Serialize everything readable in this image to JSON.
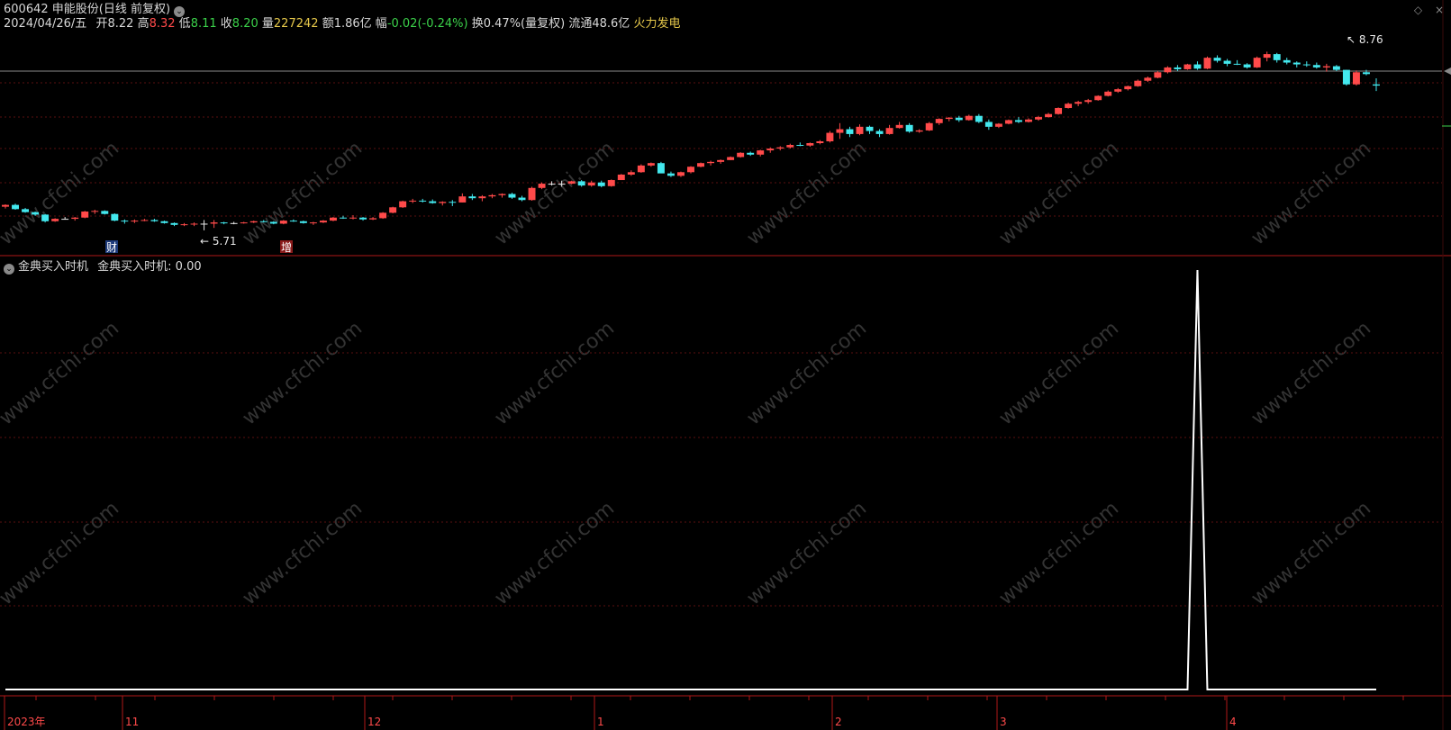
{
  "header": {
    "code": "600642",
    "name": "申能股份",
    "period": "(日线 前复权)",
    "dropdown_icon": "chevron-down-icon"
  },
  "info": {
    "date": "2024/04/26/五",
    "open_label": "开",
    "open": "8.22",
    "high_label": "高",
    "high": "8.32",
    "low_label": "低",
    "low": "8.11",
    "close_label": "收",
    "close": "8.20",
    "vol_label": "量",
    "vol": "227242",
    "amt_label": "额",
    "amt": "1.86亿",
    "chg_label": "幅",
    "chg": "-0.02(-0.24%)",
    "turn_label": "换",
    "turn": "0.47%(量复权)",
    "float_label": "流通",
    "float": "48.6亿",
    "sector": "火力发电"
  },
  "window_controls": {
    "restore": "◇",
    "close": "×"
  },
  "indicator": {
    "title": "金典买入时机",
    "line_name": "金典买入时机: 0.00"
  },
  "annotations": {
    "low_label": "5.71",
    "high_label": "8.76",
    "badge_cai": "财",
    "badge_zeng": "增"
  },
  "watermark": "www.cfchi.com",
  "colors": {
    "up": "#ff4a4a",
    "down": "#43e8ee",
    "flat": "#e8e8e8",
    "grid": "#5a0f0f",
    "axis": "#b01818",
    "price_line": "#8a8a8a"
  },
  "x_axis": {
    "labels": [
      "2023年",
      "11",
      "12",
      "1",
      "2",
      "3",
      "4"
    ]
  },
  "chart_data": {
    "type": "candlestick",
    "title": "",
    "price_range": [
      5.6,
      8.9
    ],
    "low_marker": 5.71,
    "high_marker": 8.76,
    "candles": [
      [
        6.2,
        6.24,
        6.17,
        6.23
      ],
      [
        6.23,
        6.25,
        6.15,
        6.16
      ],
      [
        6.16,
        6.18,
        6.1,
        6.11
      ],
      [
        6.11,
        6.12,
        6.05,
        6.07
      ],
      [
        6.07,
        6.08,
        5.94,
        5.96
      ],
      [
        5.96,
        6.01,
        5.95,
        6.0
      ],
      [
        6.0,
        6.03,
        5.99,
        6.0
      ],
      [
        6.0,
        6.03,
        5.97,
        6.02
      ],
      [
        6.02,
        6.13,
        6.01,
        6.12
      ],
      [
        6.12,
        6.15,
        6.08,
        6.13
      ],
      [
        6.13,
        6.14,
        6.07,
        6.08
      ],
      [
        6.08,
        6.09,
        5.96,
        5.97
      ],
      [
        5.97,
        5.99,
        5.92,
        5.96
      ],
      [
        5.96,
        5.99,
        5.93,
        5.97
      ],
      [
        5.97,
        6.0,
        5.96,
        5.98
      ],
      [
        5.98,
        6.0,
        5.95,
        5.96
      ],
      [
        5.96,
        5.97,
        5.92,
        5.93
      ],
      [
        5.93,
        5.94,
        5.88,
        5.9
      ],
      [
        5.9,
        5.93,
        5.88,
        5.91
      ],
      [
        5.91,
        5.94,
        5.88,
        5.92
      ],
      [
        5.92,
        5.98,
        5.81,
        5.92
      ],
      [
        5.92,
        5.98,
        5.85,
        5.94
      ],
      [
        5.94,
        5.95,
        5.91,
        5.93
      ],
      [
        5.93,
        5.95,
        5.91,
        5.93
      ],
      [
        5.93,
        5.95,
        5.92,
        5.94
      ],
      [
        5.94,
        5.97,
        5.93,
        5.96
      ],
      [
        5.96,
        5.98,
        5.94,
        5.95
      ],
      [
        5.95,
        5.96,
        5.91,
        5.92
      ],
      [
        5.92,
        5.98,
        5.91,
        5.97
      ],
      [
        5.97,
        5.99,
        5.95,
        5.96
      ],
      [
        5.96,
        5.97,
        5.92,
        5.93
      ],
      [
        5.93,
        5.95,
        5.9,
        5.94
      ],
      [
        5.94,
        5.98,
        5.93,
        5.97
      ],
      [
        5.97,
        6.03,
        5.96,
        6.02
      ],
      [
        6.02,
        6.05,
        6.0,
        6.01
      ],
      [
        6.01,
        6.06,
        5.99,
        6.02
      ],
      [
        6.02,
        6.03,
        5.97,
        5.99
      ],
      [
        5.99,
        6.03,
        5.98,
        6.01
      ],
      [
        6.01,
        6.11,
        6.0,
        6.1
      ],
      [
        6.1,
        6.2,
        6.09,
        6.19
      ],
      [
        6.19,
        6.3,
        6.18,
        6.29
      ],
      [
        6.29,
        6.33,
        6.26,
        6.3
      ],
      [
        6.3,
        6.33,
        6.27,
        6.29
      ],
      [
        6.29,
        6.32,
        6.25,
        6.26
      ],
      [
        6.26,
        6.29,
        6.22,
        6.28
      ],
      [
        6.28,
        6.31,
        6.21,
        6.27
      ],
      [
        6.27,
        6.42,
        6.27,
        6.37
      ],
      [
        6.37,
        6.41,
        6.31,
        6.34
      ],
      [
        6.34,
        6.39,
        6.29,
        6.37
      ],
      [
        6.37,
        6.41,
        6.34,
        6.39
      ],
      [
        6.39,
        6.42,
        6.35,
        6.41
      ],
      [
        6.41,
        6.43,
        6.33,
        6.35
      ],
      [
        6.35,
        6.38,
        6.29,
        6.31
      ],
      [
        6.31,
        6.53,
        6.3,
        6.51
      ],
      [
        6.51,
        6.6,
        6.49,
        6.58
      ],
      [
        6.58,
        6.62,
        6.55,
        6.58
      ],
      [
        6.58,
        6.63,
        6.53,
        6.58
      ],
      [
        6.58,
        6.63,
        6.57,
        6.62
      ],
      [
        6.62,
        6.64,
        6.53,
        6.55
      ],
      [
        6.55,
        6.63,
        6.53,
        6.6
      ],
      [
        6.6,
        6.63,
        6.52,
        6.54
      ],
      [
        6.54,
        6.65,
        6.53,
        6.64
      ],
      [
        6.64,
        6.74,
        6.64,
        6.73
      ],
      [
        6.73,
        6.8,
        6.71,
        6.77
      ],
      [
        6.77,
        6.9,
        6.76,
        6.88
      ],
      [
        6.88,
        6.93,
        6.86,
        6.92
      ],
      [
        6.92,
        6.94,
        6.76,
        6.75
      ],
      [
        6.75,
        6.78,
        6.69,
        6.71
      ],
      [
        6.71,
        6.78,
        6.69,
        6.77
      ],
      [
        6.77,
        6.87,
        6.75,
        6.86
      ],
      [
        6.86,
        6.93,
        6.85,
        6.92
      ],
      [
        6.92,
        6.96,
        6.88,
        6.94
      ],
      [
        6.94,
        6.98,
        6.91,
        6.97
      ],
      [
        6.97,
        7.03,
        6.97,
        7.02
      ],
      [
        7.02,
        7.1,
        7.01,
        7.09
      ],
      [
        7.09,
        7.11,
        7.04,
        7.06
      ],
      [
        7.06,
        7.14,
        7.03,
        7.13
      ],
      [
        7.13,
        7.18,
        7.09,
        7.16
      ],
      [
        7.16,
        7.2,
        7.13,
        7.18
      ],
      [
        7.18,
        7.24,
        7.16,
        7.22
      ],
      [
        7.22,
        7.26,
        7.2,
        7.21
      ],
      [
        7.21,
        7.26,
        7.19,
        7.25
      ],
      [
        7.25,
        7.3,
        7.23,
        7.28
      ],
      [
        7.28,
        7.45,
        7.26,
        7.42
      ],
      [
        7.42,
        7.58,
        7.32,
        7.48
      ],
      [
        7.48,
        7.52,
        7.35,
        7.4
      ],
      [
        7.4,
        7.56,
        7.38,
        7.52
      ],
      [
        7.52,
        7.54,
        7.4,
        7.45
      ],
      [
        7.45,
        7.48,
        7.35,
        7.4
      ],
      [
        7.4,
        7.55,
        7.39,
        7.5
      ],
      [
        7.5,
        7.6,
        7.49,
        7.55
      ],
      [
        7.55,
        7.58,
        7.42,
        7.44
      ],
      [
        7.44,
        7.48,
        7.42,
        7.46
      ],
      [
        7.46,
        7.6,
        7.45,
        7.58
      ],
      [
        7.58,
        7.66,
        7.55,
        7.65
      ],
      [
        7.65,
        7.68,
        7.61,
        7.67
      ],
      [
        7.67,
        7.7,
        7.6,
        7.63
      ],
      [
        7.63,
        7.72,
        7.62,
        7.7
      ],
      [
        7.7,
        7.73,
        7.58,
        7.6
      ],
      [
        7.6,
        7.64,
        7.47,
        7.52
      ],
      [
        7.52,
        7.58,
        7.5,
        7.57
      ],
      [
        7.57,
        7.64,
        7.56,
        7.63
      ],
      [
        7.63,
        7.68,
        7.58,
        7.6
      ],
      [
        7.6,
        7.66,
        7.59,
        7.64
      ],
      [
        7.64,
        7.7,
        7.62,
        7.68
      ],
      [
        7.68,
        7.75,
        7.67,
        7.73
      ],
      [
        7.73,
        7.84,
        7.72,
        7.83
      ],
      [
        7.83,
        7.92,
        7.82,
        7.9
      ],
      [
        7.9,
        7.95,
        7.86,
        7.93
      ],
      [
        7.93,
        7.98,
        7.9,
        7.96
      ],
      [
        7.96,
        8.04,
        7.95,
        8.03
      ],
      [
        8.03,
        8.12,
        8.02,
        8.1
      ],
      [
        8.1,
        8.16,
        8.08,
        8.14
      ],
      [
        8.14,
        8.2,
        8.12,
        8.19
      ],
      [
        8.19,
        8.3,
        8.18,
        8.28
      ],
      [
        8.28,
        8.35,
        8.26,
        8.33
      ],
      [
        8.33,
        8.44,
        8.32,
        8.42
      ],
      [
        8.42,
        8.52,
        8.4,
        8.5
      ],
      [
        8.5,
        8.54,
        8.44,
        8.47
      ],
      [
        8.47,
        8.56,
        8.46,
        8.55
      ],
      [
        8.55,
        8.6,
        8.46,
        8.48
      ],
      [
        8.48,
        8.68,
        8.47,
        8.66
      ],
      [
        8.66,
        8.7,
        8.58,
        8.61
      ],
      [
        8.61,
        8.64,
        8.52,
        8.56
      ],
      [
        8.56,
        8.62,
        8.54,
        8.55
      ],
      [
        8.55,
        8.57,
        8.48,
        8.5
      ],
      [
        8.5,
        8.68,
        8.49,
        8.66
      ],
      [
        8.66,
        8.76,
        8.6,
        8.72
      ],
      [
        8.72,
        8.74,
        8.58,
        8.62
      ],
      [
        8.62,
        8.66,
        8.55,
        8.58
      ],
      [
        8.58,
        8.6,
        8.5,
        8.55
      ],
      [
        8.55,
        8.6,
        8.51,
        8.54
      ],
      [
        8.54,
        8.58,
        8.48,
        8.5
      ],
      [
        8.5,
        8.56,
        8.43,
        8.52
      ],
      [
        8.52,
        8.54,
        8.44,
        8.46
      ],
      [
        8.46,
        8.46,
        8.2,
        8.22
      ],
      [
        8.22,
        8.45,
        8.2,
        8.42
      ],
      [
        8.42,
        8.46,
        8.37,
        8.39
      ],
      [
        8.22,
        8.32,
        8.11,
        8.2
      ]
    ],
    "indicator_series": {
      "name": "金典买入时机",
      "signal_index": 120,
      "signal_value": 100,
      "baseline": 0
    }
  }
}
